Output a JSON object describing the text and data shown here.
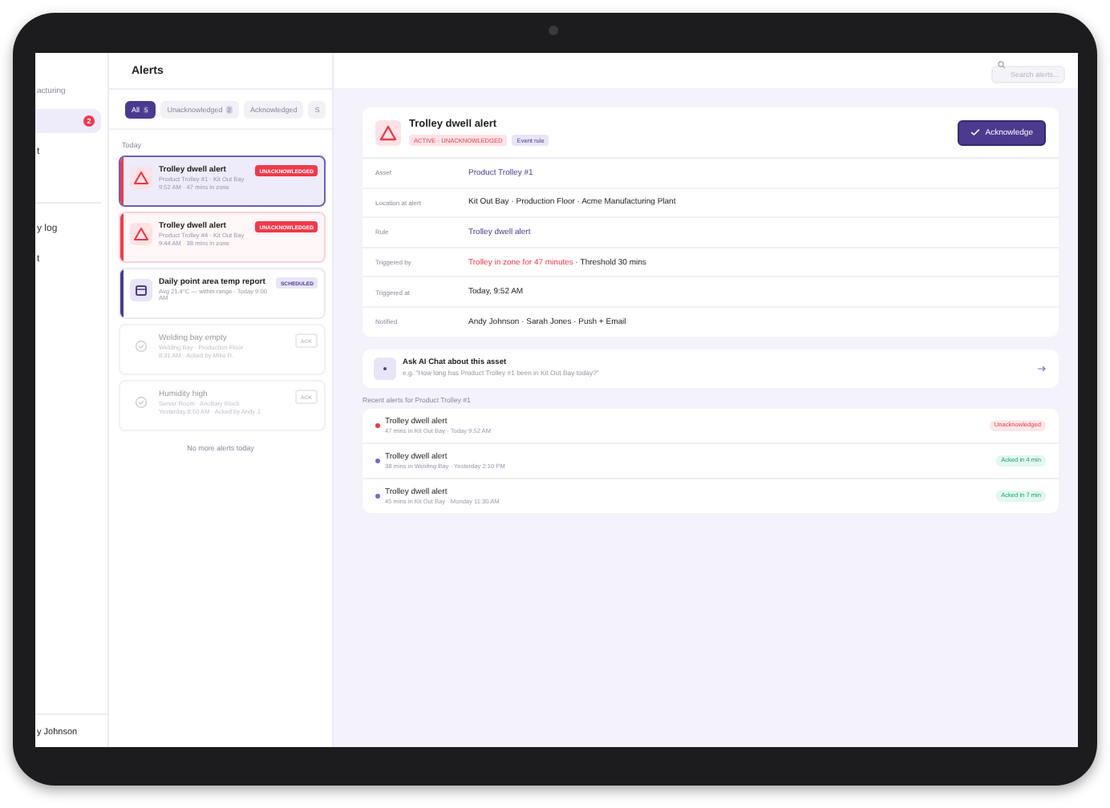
{
  "sidebar": {
    "org": "acturing",
    "groups": [
      [
        {
          "selected": true,
          "badge": "2"
        },
        {
          "label": "t",
          "selected": false
        }
      ],
      [
        {
          "label": "y log",
          "selected": false
        },
        {
          "label": "t",
          "selected": false
        }
      ]
    ],
    "user": "y Johnson"
  },
  "list": {
    "title": "Alerts",
    "filters": [
      {
        "label": "All",
        "count": "5",
        "selected": true
      },
      {
        "label": "Unacknowledged",
        "count": "2",
        "selected": false
      },
      {
        "label": "Acknowledged",
        "selected": false
      },
      {
        "label": "S",
        "selected": false
      }
    ],
    "section": "Today",
    "alerts": [
      {
        "kind": "unack",
        "title": "Trolley dwell alert",
        "line1": "Product Trolley #1 · Kit Out Bay",
        "line2": "9:52 AM · 47 mins in zone",
        "badge": "UNACKNOWLEDGED",
        "selected": true
      },
      {
        "kind": "unack",
        "title": "Trolley dwell alert",
        "line1": "Product Trolley #4 · Kit Out Bay",
        "line2": "9:44 AM · 38 mins in zone",
        "badge": "UNACKNOWLEDGED",
        "selected": false
      },
      {
        "kind": "scheduled",
        "title": "Daily point area temp report",
        "line1": "Avg 21.4°C — within range · Today 9:00 AM",
        "badge": "SCHEDULED",
        "selected": false
      },
      {
        "kind": "acked",
        "title": "Welding bay empty",
        "line1": "Welding Bay · Production Floor",
        "line2": "8:31 AM · Acked by Mike R.",
        "badge": "ACK",
        "selected": false
      },
      {
        "kind": "acked",
        "title": "Humidity high",
        "line1": "Server Room · Ancillary Block",
        "line2": "Yesterday 8:50 AM · Acked by Andy J.",
        "badge": "ACK",
        "selected": false
      }
    ],
    "end_note": "No more alerts today"
  },
  "search": {
    "placeholder": "Search alerts..."
  },
  "detail": {
    "title": "Trolley dwell alert",
    "status": "ACTIVE · UNACKNOWLEDGED",
    "tag": "Event rule",
    "button": "Acknowledge",
    "rows": [
      {
        "kind": "link",
        "label": "Asset",
        "value": "Product Trolley #1"
      },
      {
        "kind": "plain",
        "label": "Location at alert",
        "value": "Kit Out Bay · Production Floor · Acme Manufacturing Plant"
      },
      {
        "kind": "link",
        "label": "Rule",
        "value": "Trolley dwell alert"
      },
      {
        "kind": "alert",
        "label": "Triggered by",
        "alert": "Trolley in zone for 47 minutes",
        "value": " · Threshold 30 mins"
      },
      {
        "kind": "plain",
        "label": "Triggered at",
        "value": "Today, 9:52 AM"
      },
      {
        "kind": "plain",
        "label": "Notified",
        "value": "Andy Johnson · Sarah Jones · Push + Email"
      }
    ]
  },
  "ai": {
    "title": "Ask AI Chat about this asset",
    "hint": "e.g. \"How long has Product Trolley #1 been in Kit Out Bay today?\""
  },
  "recent": {
    "title": "Recent alerts for Product Trolley #1",
    "items": [
      {
        "title": "Trolley dwell alert",
        "sub": "47 mins in Kit Out Bay · Today 9:52 AM",
        "status": "Unacknowledged",
        "kind": "unack",
        "color": "#f0394a"
      },
      {
        "title": "Trolley dwell alert",
        "sub": "38 mins in Welding Bay · Yesterday 2:10 PM",
        "status": "Acked in 4 min",
        "kind": "acked",
        "color": "#7a6bc4"
      },
      {
        "title": "Trolley dwell alert",
        "sub": "45 mins in Kit Out Bay · Monday 11:30 AM",
        "status": "Acked in 7 min",
        "kind": "acked",
        "color": "#7a6bc4"
      }
    ]
  }
}
